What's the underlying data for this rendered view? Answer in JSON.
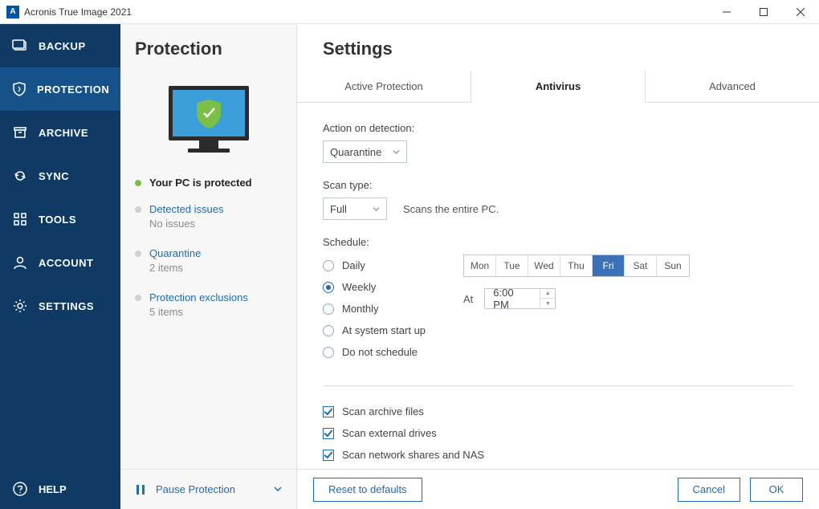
{
  "titlebar": {
    "title": "Acronis True Image 2021"
  },
  "sidebar": {
    "items": [
      {
        "label": "BACKUP"
      },
      {
        "label": "PROTECTION"
      },
      {
        "label": "ARCHIVE"
      },
      {
        "label": "SYNC"
      },
      {
        "label": "TOOLS"
      },
      {
        "label": "ACCOUNT"
      },
      {
        "label": "SETTINGS"
      }
    ],
    "help": "HELP"
  },
  "panel": {
    "heading": "Protection",
    "status": "Your PC is protected",
    "links": [
      {
        "title": "Detected issues",
        "sub": "No issues"
      },
      {
        "title": "Quarantine",
        "sub": "2 items"
      },
      {
        "title": "Protection exclusions",
        "sub": "5 items"
      }
    ],
    "pause": "Pause Protection"
  },
  "settings": {
    "heading": "Settings",
    "tabs": [
      {
        "label": "Active Protection"
      },
      {
        "label": "Antivirus"
      },
      {
        "label": "Advanced"
      }
    ],
    "action_label": "Action on detection:",
    "action_value": "Quarantine",
    "scantype_label": "Scan type:",
    "scantype_value": "Full",
    "scantype_desc": "Scans the entire PC.",
    "schedule_label": "Schedule:",
    "radios": [
      {
        "label": "Daily"
      },
      {
        "label": "Weekly"
      },
      {
        "label": "Monthly"
      },
      {
        "label": "At system start up"
      },
      {
        "label": "Do not schedule"
      }
    ],
    "days": [
      "Mon",
      "Tue",
      "Wed",
      "Thu",
      "Fri",
      "Sat",
      "Sun"
    ],
    "selected_day_index": 4,
    "at_label": "At",
    "time_value": "6:00 PM",
    "checks": [
      {
        "label": "Scan archive files"
      },
      {
        "label": "Scan external drives"
      },
      {
        "label": "Scan network shares and NAS"
      }
    ],
    "reset_btn": "Reset to defaults",
    "cancel_btn": "Cancel",
    "ok_btn": "OK"
  }
}
